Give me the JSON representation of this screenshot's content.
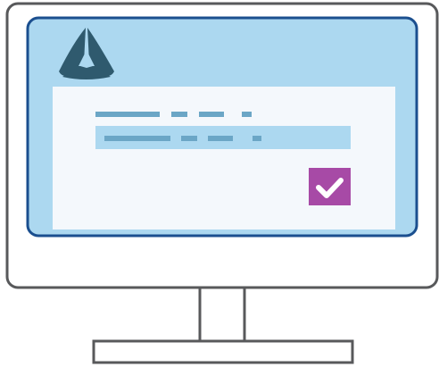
{
  "illustration": {
    "type": "computer-monitor",
    "logo_icon": "tri-blade-logo-icon",
    "form_content": "placeholder-dashed-lines",
    "checkbox_state": "checked",
    "checkbox_icon": "checkmark-icon"
  },
  "colors": {
    "outline": "#58595b",
    "screen_border": "#1b4f8f",
    "screen_fill": "#acd8f0",
    "panel_fill": "#f4f8fc",
    "placeholder_text": "#6ba6c6",
    "input_fill": "#acd8f0",
    "checkbox_fill": "#a74aa6",
    "logo_fill": "#2f5a6e",
    "background": "#ffffff"
  }
}
